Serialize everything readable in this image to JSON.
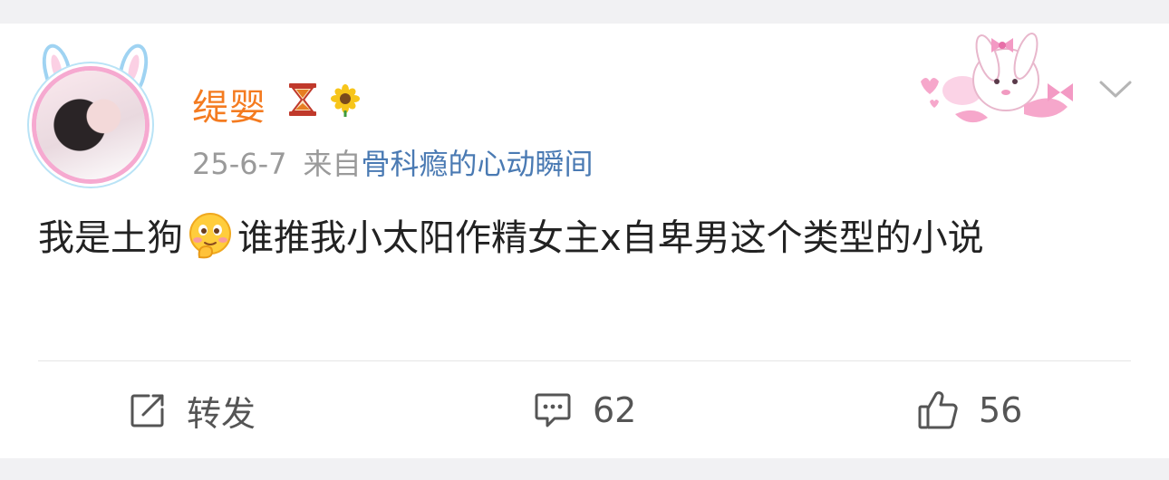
{
  "post": {
    "username": "缇婴",
    "date": "25-6-7",
    "from_label": "来自",
    "source": "骨科瘾的心动瞬间",
    "text_part1": "我是土狗",
    "text_part2": "谁推我小太阳作精女主x自卑男这个类型的小说"
  },
  "actions": {
    "repost_label": "转发",
    "comment_count": "62",
    "like_count": "56"
  },
  "icons": {
    "avatar": "avatar-bunny-frame",
    "badge1": "hourglass-icon",
    "badge2": "sunflower-icon",
    "emoji": "thinking-emoji-icon",
    "more": "chevron-down-icon",
    "repost": "repost-icon",
    "comment": "comment-icon",
    "like": "thumbs-up-icon"
  },
  "colors": {
    "username": "#f47b20",
    "source_link": "#4a7ab3",
    "meta": "#9a9a9a",
    "text": "#222222"
  }
}
